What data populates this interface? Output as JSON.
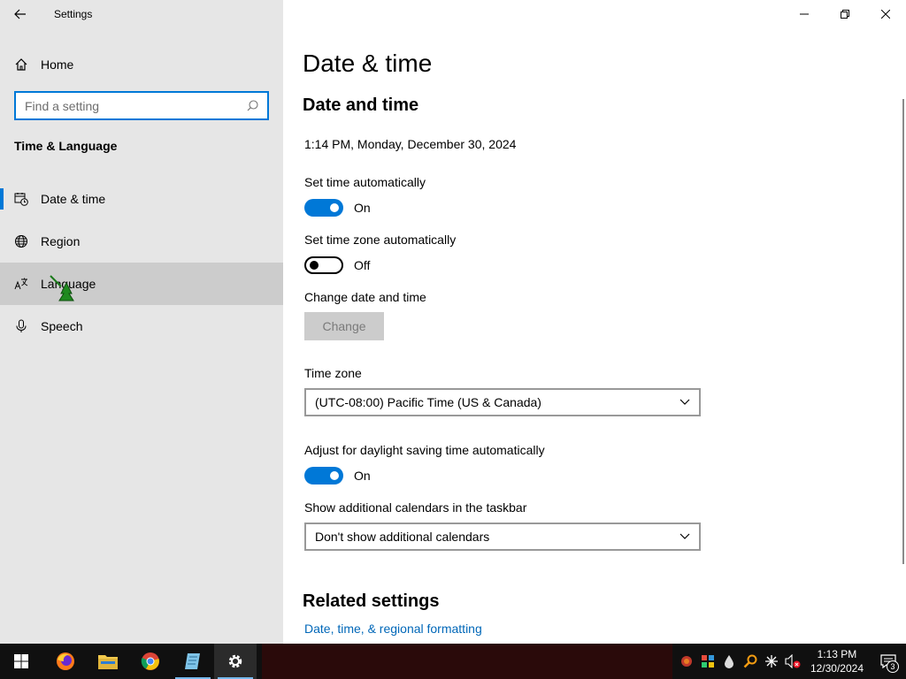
{
  "window": {
    "app_title": "Settings"
  },
  "sidebar": {
    "home_label": "Home",
    "search_placeholder": "Find a setting",
    "section_title": "Time & Language",
    "items": [
      {
        "label": "Date & time",
        "icon": "calendar-clock-icon"
      },
      {
        "label": "Region",
        "icon": "globe-icon"
      },
      {
        "label": "Language",
        "icon": "language-icon"
      },
      {
        "label": "Speech",
        "icon": "microphone-icon"
      }
    ]
  },
  "main": {
    "page_title": "Date & time",
    "section_title": "Date and time",
    "current_datetime": "1:14 PM, Monday, December 30, 2024",
    "set_time_auto": {
      "label": "Set time automatically",
      "state": "On"
    },
    "set_timezone_auto": {
      "label": "Set time zone automatically",
      "state": "Off"
    },
    "change_datetime": {
      "label": "Change date and time",
      "button": "Change"
    },
    "time_zone": {
      "label": "Time zone",
      "value": "(UTC-08:00) Pacific Time (US & Canada)"
    },
    "daylight_saving": {
      "label": "Adjust for daylight saving time automatically",
      "state": "On"
    },
    "additional_calendars": {
      "label": "Show additional calendars in the taskbar",
      "value": "Don't show additional calendars"
    },
    "related_title": "Related settings",
    "related_link": "Date, time, & regional formatting"
  },
  "taskbar": {
    "time": "1:13 PM",
    "date": "12/30/2024",
    "notification_count": "3"
  },
  "colors": {
    "accent": "#0078d7",
    "link": "#0067b8",
    "sidebar_bg": "#e6e6e6"
  }
}
